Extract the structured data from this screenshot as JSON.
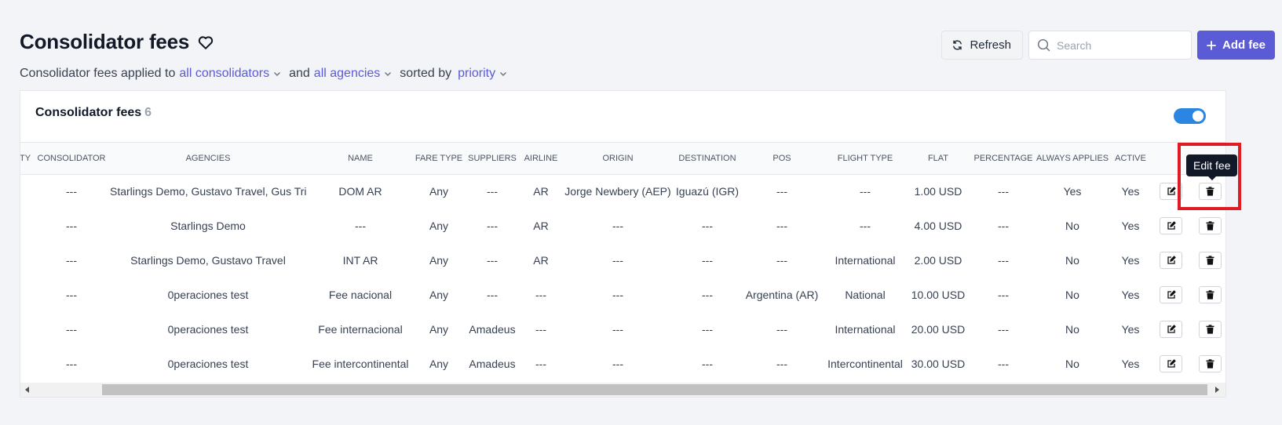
{
  "header": {
    "title": "Consolidator fees",
    "subtitle": {
      "prefix": "Consolidator fees applied to",
      "consolidators": "all consolidators",
      "and": "and",
      "agencies": "all agencies",
      "sorted_by": "sorted by",
      "sort": "priority"
    }
  },
  "toolbar": {
    "refresh_label": "Refresh",
    "search_placeholder": "Search",
    "add_label": "Add fee"
  },
  "card": {
    "title": "Consolidator fees",
    "count": "6",
    "toggle_on": true
  },
  "table": {
    "columns": [
      "ity",
      "Consolidator",
      "Agencies",
      "Name",
      "Fare type",
      "Suppliers",
      "Airline",
      "Origin",
      "Destination",
      "POS",
      "Flight type",
      "Flat",
      "Percentage",
      "Always applies",
      "Active"
    ],
    "rows": [
      {
        "consolidator": "---",
        "agencies": "Starlings Demo, Gustavo Travel, Gus Trial",
        "name": "DOM AR",
        "fare_type": "Any",
        "suppliers": "---",
        "airline": "AR",
        "origin": "Jorge Newbery (AEP)",
        "destination": "Iguazú (IGR)",
        "pos": "---",
        "flight_type": "---",
        "flat": "1.00 USD",
        "percentage": "---",
        "always_applies": "Yes",
        "active": "Yes"
      },
      {
        "consolidator": "---",
        "agencies": "Starlings Demo",
        "name": "---",
        "fare_type": "Any",
        "suppliers": "---",
        "airline": "AR",
        "origin": "---",
        "destination": "---",
        "pos": "---",
        "flight_type": "---",
        "flat": "4.00 USD",
        "percentage": "---",
        "always_applies": "No",
        "active": "Yes"
      },
      {
        "consolidator": "---",
        "agencies": "Starlings Demo, Gustavo Travel",
        "name": "INT AR",
        "fare_type": "Any",
        "suppliers": "---",
        "airline": "AR",
        "origin": "---",
        "destination": "---",
        "pos": "---",
        "flight_type": "International",
        "flat": "2.00 USD",
        "percentage": "---",
        "always_applies": "No",
        "active": "Yes"
      },
      {
        "consolidator": "---",
        "agencies": "0peraciones test",
        "name": "Fee nacional",
        "fare_type": "Any",
        "suppliers": "---",
        "airline": "---",
        "origin": "---",
        "destination": "---",
        "pos": "Argentina (AR)",
        "flight_type": "National",
        "flat": "10.00 USD",
        "percentage": "---",
        "always_applies": "No",
        "active": "Yes"
      },
      {
        "consolidator": "---",
        "agencies": "0peraciones test",
        "name": "Fee internacional",
        "fare_type": "Any",
        "suppliers": "Amadeus",
        "airline": "---",
        "origin": "---",
        "destination": "---",
        "pos": "---",
        "flight_type": "International",
        "flat": "20.00 USD",
        "percentage": "---",
        "always_applies": "No",
        "active": "Yes"
      },
      {
        "consolidator": "---",
        "agencies": "0peraciones test",
        "name": "Fee intercontinental",
        "fare_type": "Any",
        "suppliers": "Amadeus",
        "airline": "---",
        "origin": "---",
        "destination": "---",
        "pos": "---",
        "flight_type": "Intercontinental",
        "flat": "30.00 USD",
        "percentage": "---",
        "always_applies": "No",
        "active": "Yes"
      }
    ]
  },
  "tooltip": {
    "text": "Edit fee"
  },
  "colors": {
    "accent": "#5b5bd6",
    "toggle": "#2b86e3",
    "highlight": "#e01b24"
  },
  "icons": [
    "heart-icon",
    "chevron-down-icon",
    "refresh-icon",
    "search-icon",
    "plus-icon",
    "edit-icon",
    "trash-icon"
  ]
}
